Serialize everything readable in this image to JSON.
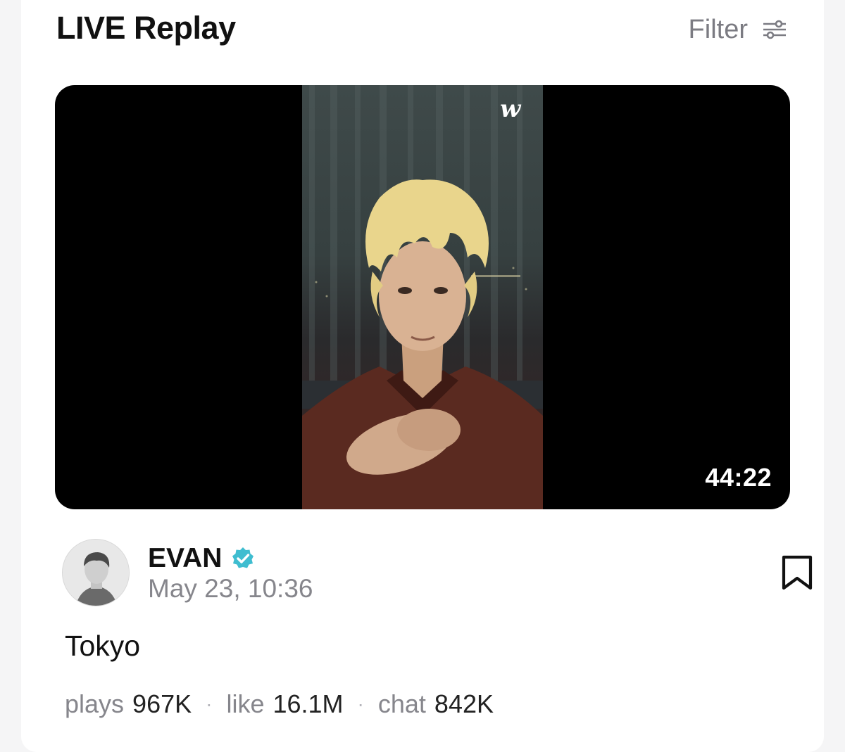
{
  "header": {
    "title": "LIVE Replay",
    "filter_label": "Filter"
  },
  "video": {
    "watermark": "w",
    "duration": "44:22"
  },
  "post": {
    "author": "EVAN",
    "date": "May 23, 10:36",
    "caption": "Tokyo"
  },
  "stats": {
    "plays_label": "plays",
    "plays_value": "967K",
    "like_label": "like",
    "like_value": "16.1M",
    "chat_label": "chat",
    "chat_value": "842K",
    "separator": "·"
  },
  "colors": {
    "verified_badge": "#3fbdd0",
    "muted_text": "#86868c"
  },
  "icons": {
    "filter": "sliders-icon",
    "verified": "verified-badge-icon",
    "bookmark": "bookmark-icon"
  }
}
